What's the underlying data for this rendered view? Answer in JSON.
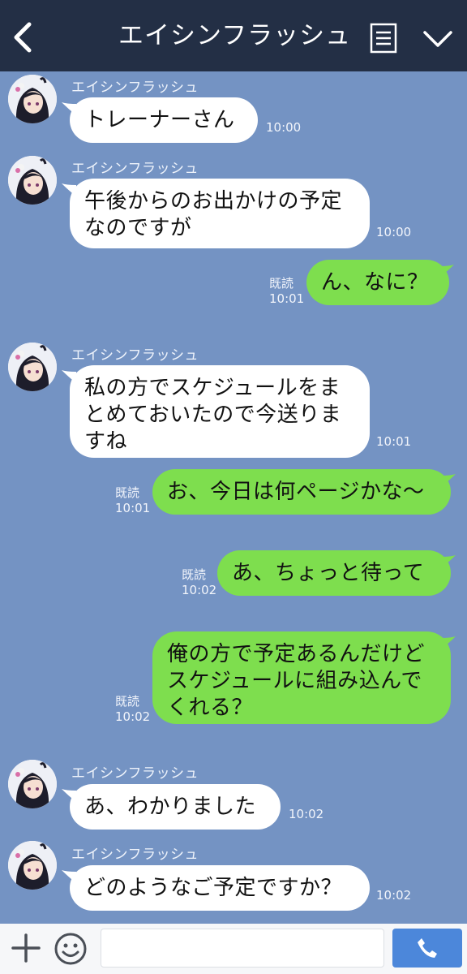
{
  "header": {
    "title": "エイシンフラッシュ",
    "icons": [
      "back-icon",
      "menu-icon",
      "chevron-down-icon"
    ]
  },
  "messages": [
    {
      "side": "in",
      "sender": "エイシンフラッシュ",
      "text": "トレーナーさん",
      "time": "10:00"
    },
    {
      "side": "in",
      "sender": "エイシンフラッシュ",
      "text": "午後からのお出かけの予定\nなのですが",
      "time": "10:00"
    },
    {
      "side": "out",
      "read": "既読",
      "text": "ん、なに？",
      "time": "10:01"
    },
    {
      "side": "in",
      "sender": "エイシンフラッシュ",
      "text": "私の方でスケジュールをま\nとめておいたので今送りま\nすね",
      "time": "10:01"
    },
    {
      "side": "out",
      "read": "既読",
      "text": "お、今日は何ページかな〜",
      "time": "10:01"
    },
    {
      "side": "out",
      "read": "既読",
      "text": "あ、ちょっと待って",
      "time": "10:02"
    },
    {
      "side": "out",
      "read": "既読",
      "text": "俺の方で予定あるんだけど\nスケジュールに組み込んで\nくれる？",
      "time": "10:02"
    },
    {
      "side": "in",
      "sender": "エイシンフラッシュ",
      "text": "あ、わかりました",
      "time": "10:02"
    },
    {
      "side": "in",
      "sender": "エイシンフラッシュ",
      "text": "どのようなご予定ですか？",
      "time": "10:02"
    }
  ],
  "footer": {
    "input_value": "",
    "icons": [
      "plus-icon",
      "smile-icon",
      "phone-icon"
    ]
  },
  "colors": {
    "header_bg": "#232f45",
    "chat_bg": "#7493c3",
    "incoming_bubble": "#ffffff",
    "outgoing_bubble": "#7ede4e",
    "call_button": "#4c87da"
  }
}
